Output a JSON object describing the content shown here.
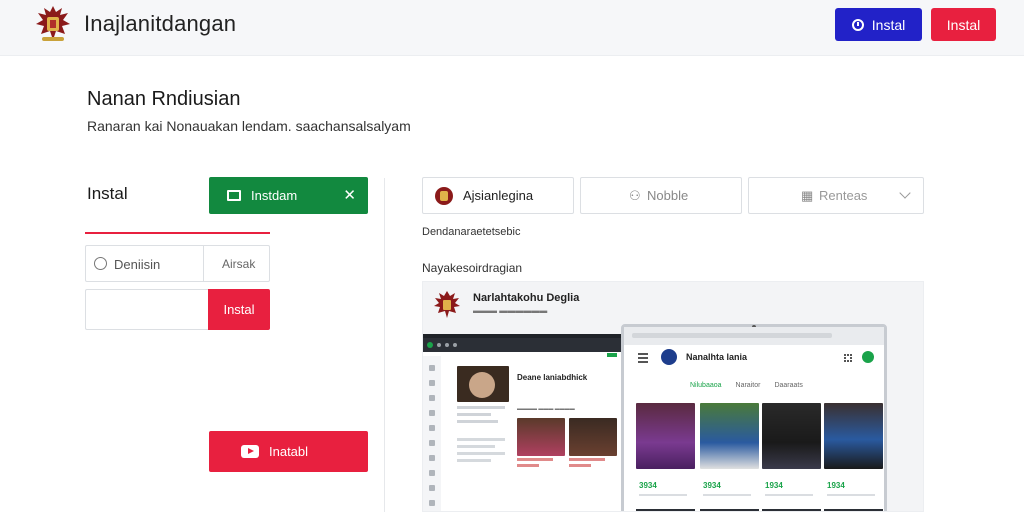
{
  "header": {
    "app_title": "Inajlanitdangan",
    "install_button_label": "Instal",
    "install_button_2_label": "Instal"
  },
  "main": {
    "title": "Nanan Rndiusian",
    "subtitle": "Ranaran kai Nonauakan lendam. saachansalsalyam"
  },
  "left_panel": {
    "install_label": "Instal",
    "green_button_label": "Instdam",
    "option_label": "Deniisin",
    "option_value": "Airsak",
    "input_value": "",
    "input_button_label": "Instal",
    "youtube_button_label": "Inatabl"
  },
  "right_panel": {
    "tabs": [
      {
        "label": "Ajsianlegina"
      },
      {
        "label": "Nobble"
      },
      {
        "label": "Renteas"
      }
    ],
    "description": "Dendanaraetetsebic",
    "section_label": "Nayakesoirdragian",
    "preview": {
      "title": "Narlahtakohu Deglia",
      "laptop_heading": "Deane laniabdhick",
      "tablet_title": "Nanalhta lania",
      "tablet_tabs": [
        "Nilubaaoa",
        "Naraitor",
        "Daaraats"
      ],
      "prices": [
        "3934",
        "3934",
        "1934",
        "1934"
      ]
    }
  },
  "colors": {
    "primary_blue": "#2222c8",
    "accent_red": "#e8203f",
    "success_green": "#12893f"
  }
}
